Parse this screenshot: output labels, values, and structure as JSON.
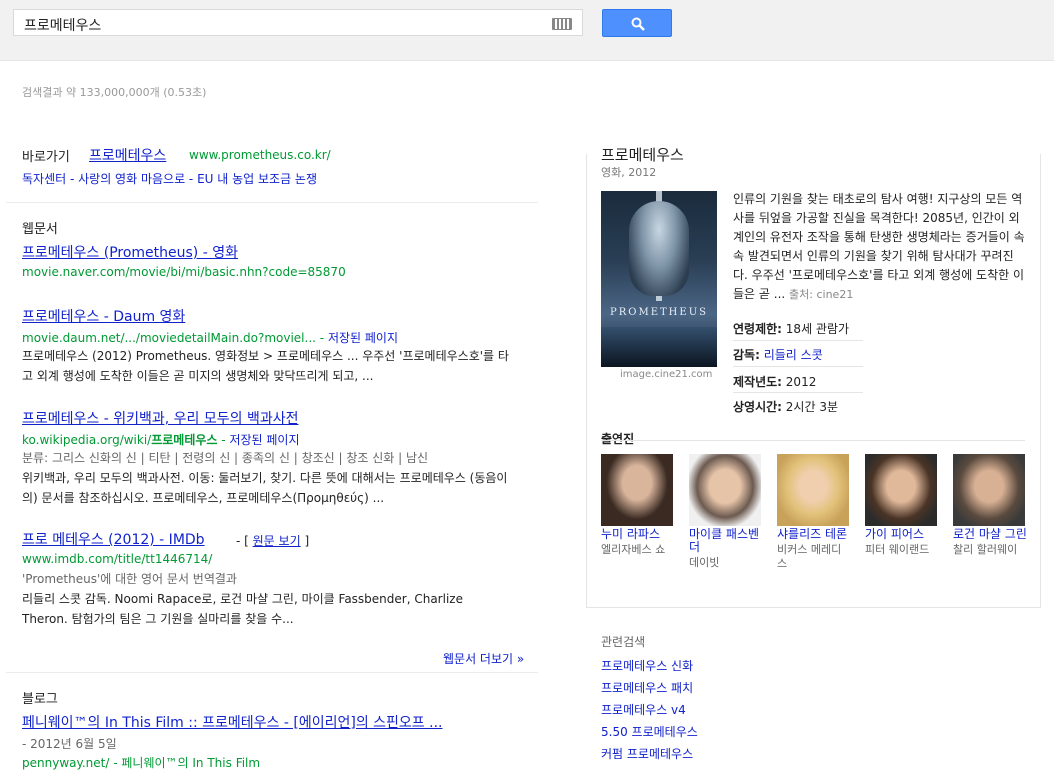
{
  "search": {
    "query": "프로메테우스"
  },
  "stats": "검색결과 약 133,000,000개 (0.53초)",
  "shortcut": {
    "label": "바로가기",
    "title": "프로메테우스",
    "url": "www.prometheus.co.kr/",
    "sitelinks": "독자센터 - 사랑의 영화 마음으로 - EU 내 농업 보조금 논쟁"
  },
  "web": {
    "heading": "웹문서",
    "results": [
      {
        "title": "프로메테우스 (Prometheus) - 영화",
        "url": "movie.naver.com/movie/bi/mi/basic.nhn?code=85870"
      },
      {
        "title": "프로메테우스 - Daum 영화",
        "url": "movie.daum.net/.../moviedetailMain.do?moviel...",
        "cached": "저장된 페이지",
        "snippet": "프로메테우스 (2012) Prometheus. 영화정보 > 프로메테우스 ... 우주선 '프로메테우스호'를 타고 외계 행성에 도착한 이들은 곧 미지의 생명체와 맞닥뜨리게 되고, ..."
      },
      {
        "title": "프로메테우스 - 위키백과, 우리 모두의 백과사전",
        "url_pre": "ko.wikipedia.org/wiki/",
        "url_bold": "프로메테우스",
        "cached": "저장된 페이지",
        "snippet1": "분류: 그리스 신화의 신 | 티탄 | 전령의 신 | 종족의 신 | 창조신 | 창조 신화 | 남신",
        "snippet2": "위키백과, 우리 모두의 백과사전. 이동: 둘러보기, 찾기. 다른 뜻에 대해서는 프로메테우스 (동음이의) 문서를 참조하십시오. 프로메테우스, 프로메테우스(Προμηθεύς) ..."
      },
      {
        "title": "프로 메테우스 (2012) - IMDb",
        "orig": "원문 보기",
        "url": "www.imdb.com/title/tt1446714/",
        "snippet1": "'Prometheus'에 대한 영어 문서 번역결과",
        "snippet2": "리들리 스콧 감독. Noomi Rapace로, 로건 마샬 그린, 마이클 Fassbender, Charlize Theron. 탐험가의 팀은 그 기원을 실마리를 찾을 수..."
      }
    ],
    "more": "웹문서 더보기 »"
  },
  "blog": {
    "heading": "블로그",
    "title": "페니웨이™의 In This Film :: 프로메테우스 - [에이리언]의 스핀오프 ...",
    "date": "- 2012년 6월 5일",
    "url": "pennyway.net/ - 페니웨이™의 In This Film"
  },
  "panel": {
    "title": "프로메테우스",
    "subtitle": "영화, 2012",
    "poster_text": "PROMETHEUS",
    "image_credit": "image.cine21.com",
    "description": "인류의 기원을 찾는 태초로의 탐사 여행! 지구상의 모든 역사를 뒤엎을 가공할 진실을 목격한다! 2085년, 인간이 외계인의 유전자 조작을 통해 탄생한 생명체라는 증거들이 속속 발견되면서 인류의 기원을 찾기 위해 탐사대가 꾸려진다. 우주선 '프로메테우스호'를 타고 외계 행성에 도착한 이들은 곧 ...",
    "source": "출처: cine21",
    "facts": [
      {
        "label": "연령제한:",
        "value": "18세 관람가"
      },
      {
        "label": "감독:",
        "value": "리들리 스콧"
      },
      {
        "label": "제작년도:",
        "value": "2012"
      },
      {
        "label": "상영시간:",
        "value": "2시간 3분"
      }
    ],
    "cast_heading": "출연진",
    "cast": [
      {
        "name": "누미 라파스",
        "role": "엘리자베스 쇼"
      },
      {
        "name": "마이클 패스벤더",
        "role": "데이빗"
      },
      {
        "name": "샤를리즈 테론",
        "role": "비커스 메레디스"
      },
      {
        "name": "가이 피어스",
        "role": "피터 웨이랜드"
      },
      {
        "name": "로건 마샬 그린",
        "role": "찰리 할러웨이"
      }
    ]
  },
  "related": {
    "heading": "관련검색",
    "items": [
      "프로메테우스 신화",
      "프로메테우스 패치",
      "프로메테우스 v4",
      "5.50 프로메테우스",
      "커펌 프로메테우스"
    ]
  }
}
